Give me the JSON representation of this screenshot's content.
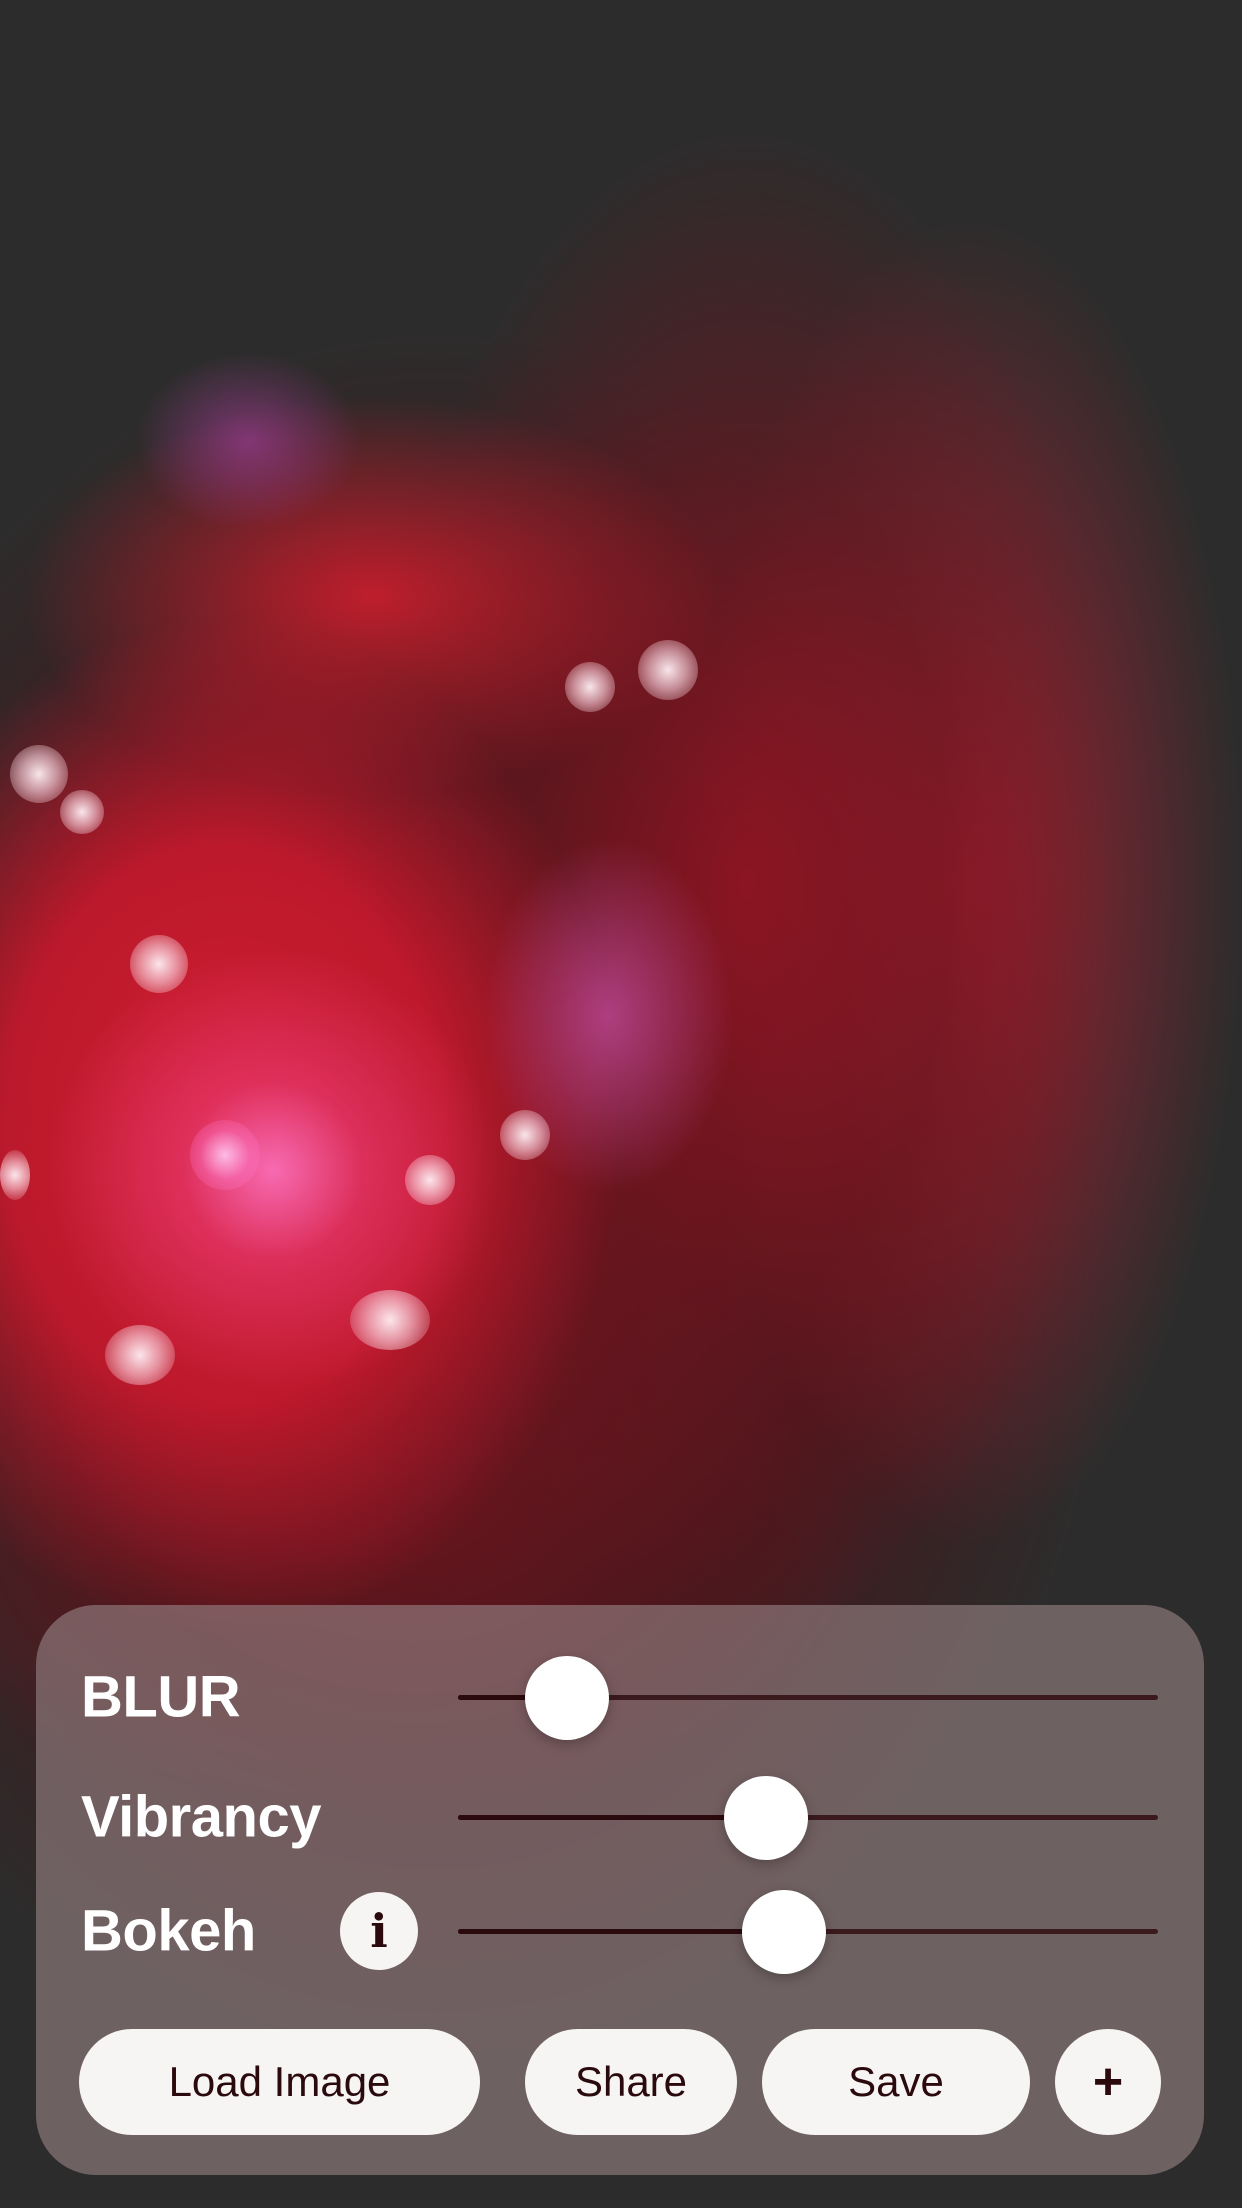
{
  "screen": {
    "background_color": "#2d2c2c",
    "image_description_icon": "blurred-photo"
  },
  "panel": {
    "sliders": [
      {
        "label": "BLUR",
        "value_fraction": 0.155
      },
      {
        "label": "Vibrancy",
        "value_fraction": 0.44
      },
      {
        "label": "Bokeh",
        "value_fraction": 0.465,
        "info_button_label": "i"
      }
    ],
    "buttons": {
      "load_image": "Load Image",
      "share": "Share",
      "save": "Save",
      "add": "+"
    },
    "colors": {
      "panel": "#968284",
      "button_bg": "#f7f4f4",
      "button_text": "#2a0a0d",
      "label_text": "#ffffff",
      "thumb": "#ffffff"
    }
  }
}
